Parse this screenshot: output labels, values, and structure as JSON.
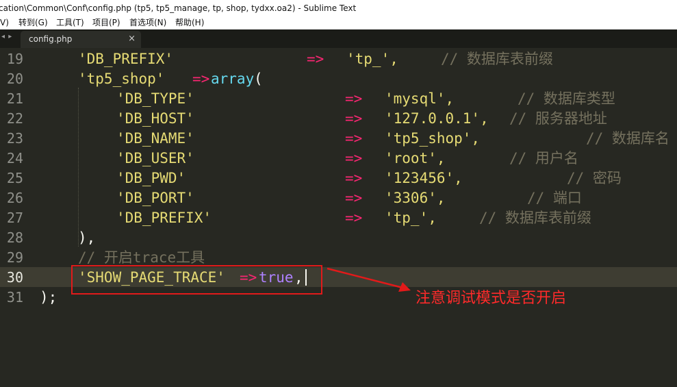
{
  "window": {
    "title": "cation\\Common\\Conf\\config.php (tp5, tp5_manage, tp, shop, tydxx.oa2) - Sublime Text"
  },
  "menu": {
    "items": [
      "V)",
      "转到(G)",
      "工具(T)",
      "项目(P)",
      "首选项(N)",
      "帮助(H)"
    ]
  },
  "tabs": {
    "active_label": "config.php",
    "close_glyph": "×",
    "nav_glyph": "◂ ▸"
  },
  "editor": {
    "current_line": "30",
    "line_numbers": [
      "19",
      "20",
      "21",
      "22",
      "23",
      "24",
      "25",
      "26",
      "27",
      "28",
      "29",
      "30",
      "31"
    ],
    "lines": [
      {
        "parts": [
          {
            "t": "'DB_PREFIX'",
            "c": "str"
          },
          {
            "t": "=>",
            "c": "op"
          },
          {
            "t": "'tp_',",
            "c": "str"
          },
          {
            "t": "// 数据库表前缀",
            "c": "cmt"
          }
        ]
      },
      {
        "parts": [
          {
            "t": "'tp5_shop'",
            "c": "str"
          },
          {
            "t": "=>",
            "c": "op"
          },
          {
            "t": "array",
            "c": "kw"
          },
          {
            "t": "(",
            "c": "pun"
          }
        ]
      },
      {
        "parts": [
          {
            "t": "'DB_TYPE'",
            "c": "str"
          },
          {
            "t": "=>",
            "c": "op"
          },
          {
            "t": "'mysql',",
            "c": "str"
          },
          {
            "t": "// 数据库类型",
            "c": "cmt"
          }
        ]
      },
      {
        "parts": [
          {
            "t": "'DB_HOST'",
            "c": "str"
          },
          {
            "t": "=>",
            "c": "op"
          },
          {
            "t": "'127.0.0.1',",
            "c": "str"
          },
          {
            "t": "// 服务器地址",
            "c": "cmt"
          }
        ]
      },
      {
        "parts": [
          {
            "t": "'DB_NAME'",
            "c": "str"
          },
          {
            "t": "=>",
            "c": "op"
          },
          {
            "t": "'tp5_shop',",
            "c": "str"
          },
          {
            "t": "// 数据库名",
            "c": "cmt"
          }
        ]
      },
      {
        "parts": [
          {
            "t": "'DB_USER'",
            "c": "str"
          },
          {
            "t": "=>",
            "c": "op"
          },
          {
            "t": "'root',",
            "c": "str"
          },
          {
            "t": "// 用户名",
            "c": "cmt"
          }
        ]
      },
      {
        "parts": [
          {
            "t": "'DB_PWD'",
            "c": "str"
          },
          {
            "t": "=>",
            "c": "op"
          },
          {
            "t": "'123456',",
            "c": "str"
          },
          {
            "t": "// 密码",
            "c": "cmt"
          }
        ]
      },
      {
        "parts": [
          {
            "t": "'DB_PORT'",
            "c": "str"
          },
          {
            "t": "=>",
            "c": "op"
          },
          {
            "t": "'3306',",
            "c": "str"
          },
          {
            "t": "// 端口",
            "c": "cmt"
          }
        ]
      },
      {
        "parts": [
          {
            "t": "'DB_PREFIX'",
            "c": "str"
          },
          {
            "t": "=>",
            "c": "op"
          },
          {
            "t": "'tp_',",
            "c": "str"
          },
          {
            "t": "// 数据库表前缀",
            "c": "cmt"
          }
        ]
      },
      {
        "parts": [
          {
            "t": "),",
            "c": "pun"
          }
        ]
      },
      {
        "parts": [
          {
            "t": "// 开启trace工具",
            "c": "cmt"
          }
        ]
      },
      {
        "parts": [
          {
            "t": "'SHOW_PAGE_TRACE'",
            "c": "str"
          },
          {
            "t": "=>",
            "c": "op"
          },
          {
            "t": "true",
            "c": "con"
          },
          {
            "t": ",",
            "c": "pun"
          }
        ]
      },
      {
        "parts": [
          {
            "t": ");",
            "c": "pun"
          }
        ]
      }
    ]
  },
  "annotation": {
    "text": "注意调试模式是否开启",
    "color": "#ff2a2a"
  },
  "colors": {
    "background": "#272822",
    "string": "#e6db74",
    "operator": "#f92672",
    "keyword": "#66d9ef",
    "constant": "#ae81ff",
    "comment": "#75715e",
    "highlight_box": "#e21a1a"
  }
}
